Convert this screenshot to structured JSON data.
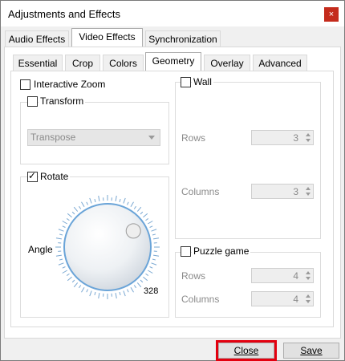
{
  "window": {
    "title": "Adjustments and Effects",
    "close_glyph": "×"
  },
  "main_tabs": [
    {
      "label": "Audio Effects",
      "active": false
    },
    {
      "label": "Video Effects",
      "active": true
    },
    {
      "label": "Synchronization",
      "active": false
    }
  ],
  "sub_tabs": [
    {
      "label": "Essential",
      "active": false
    },
    {
      "label": "Crop",
      "active": false
    },
    {
      "label": "Colors",
      "active": false
    },
    {
      "label": "Geometry",
      "active": true
    },
    {
      "label": "Overlay",
      "active": false
    },
    {
      "label": "Advanced",
      "active": false
    }
  ],
  "geometry": {
    "interactive_zoom": {
      "label": "Interactive Zoom",
      "checked": false
    },
    "transform": {
      "label": "Transform",
      "checked": false,
      "select_value": "Transpose"
    },
    "rotate": {
      "label": "Rotate",
      "checked": true,
      "dial_label": "Angle",
      "angle_value": "328",
      "angle_degrees": 328
    },
    "wall": {
      "label": "Wall",
      "checked": false,
      "rows_label": "Rows",
      "rows_value": "3",
      "columns_label": "Columns",
      "columns_value": "3"
    },
    "puzzle": {
      "label": "Puzzle game",
      "checked": false,
      "rows_label": "Rows",
      "rows_value": "4",
      "columns_label": "Columns",
      "columns_value": "4"
    }
  },
  "footer": {
    "close_label": "Close",
    "save_label": "Save"
  },
  "colors": {
    "highlight": "#e3000f",
    "title_close_bg": "#c42b1c"
  }
}
